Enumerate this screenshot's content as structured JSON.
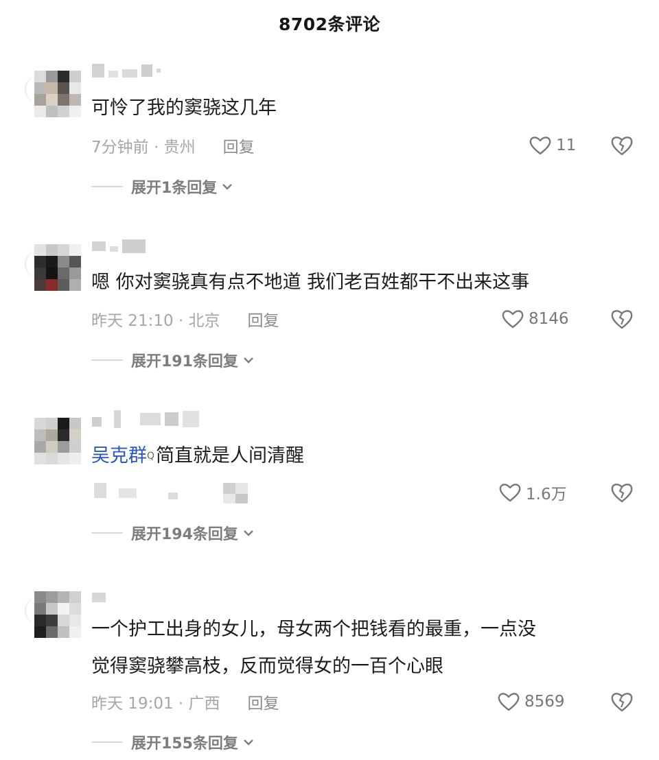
{
  "header": {
    "title": "8702条评论"
  },
  "comments": [
    {
      "text": "可怜了我的窦骁这几年",
      "time_location": "7分钟前 · 贵州",
      "reply": "回复",
      "likes": "11",
      "expand": "展开1条回复",
      "avatar_colors": [
        "#dcdcdc",
        "#9a9a9a",
        "#2a2a2a",
        "#cfcfcf",
        "#b9b9b9",
        "#c8b8a8",
        "#5a5450",
        "#e8e8e8",
        "#a8a29c",
        "#d9d0c6",
        "#7c7470",
        "#c0b8b0",
        "#eaeaea",
        "#bfbfbf",
        "#d0d0d0",
        "#f0f0f0"
      ]
    },
    {
      "text": "嗯 你对窦骁真有点不地道 我们老百姓都干不出来这事",
      "time_location": "昨天 21:10 · 北京",
      "reply": "回复",
      "likes": "8146",
      "expand": "展开191条回复",
      "avatar_colors": [
        "#e2e2e2",
        "#c8c8c8",
        "#d6d6d6",
        "#f0f0f0",
        "#2c2c2c",
        "#1a1a1a",
        "#8a8a8a",
        "#555555",
        "#3a3a3a",
        "#141414",
        "#6a6a6a",
        "#9a9a9a",
        "#4b3a3a",
        "#8a2b2b",
        "#5c5c5c",
        "#b0b0b0"
      ]
    },
    {
      "prefix": "吴克群",
      "mention_mark": "Q",
      "text": "简直就是人间清醒",
      "reply": "回复",
      "likes": "1.6万",
      "expand": "展开194条回复",
      "avatar_colors": [
        "#d8d8d8",
        "#cfcfcf",
        "#1a1a1a",
        "#c8c8c8",
        "#bdbdbd",
        "#b0a89e",
        "#2a2a2a",
        "#d4d0c8",
        "#a9a9a9",
        "#d2cbc0",
        "#9c9c9c",
        "#cfcfcf",
        "#e0e0e0",
        "#d9d9d9",
        "#e6e6e6",
        "#eeeeee"
      ]
    },
    {
      "text_lines": [
        "一个护工出身的女儿，母女两个把钱看的最重，一点没",
        "觉得窦骁攀高枝，反而觉得女的一百个心眼"
      ],
      "time_location": "昨天 19:01 · 广西",
      "reply": "回复",
      "likes": "8569",
      "expand": "展开155条回复",
      "avatar_colors": [
        "#8a8a8a",
        "#9c9c9c",
        "#b4b4b4",
        "#d0d0d0",
        "#7a7a7a",
        "#c8c8c8",
        "#f2f2f2",
        "#dcdcdc",
        "#2a2a2a",
        "#3c3c3c",
        "#d8d8d8",
        "#e8e8e8",
        "#1e1e1e",
        "#6a6a6a",
        "#c0c0c0",
        "#f0f0f0"
      ]
    }
  ],
  "icons": {
    "like": "heart-outline-icon",
    "dislike": "broken-heart-icon",
    "expand": "chevron-down-icon"
  },
  "colors": {
    "mention": "#2a57c4",
    "meta": "#a6a6a6"
  }
}
